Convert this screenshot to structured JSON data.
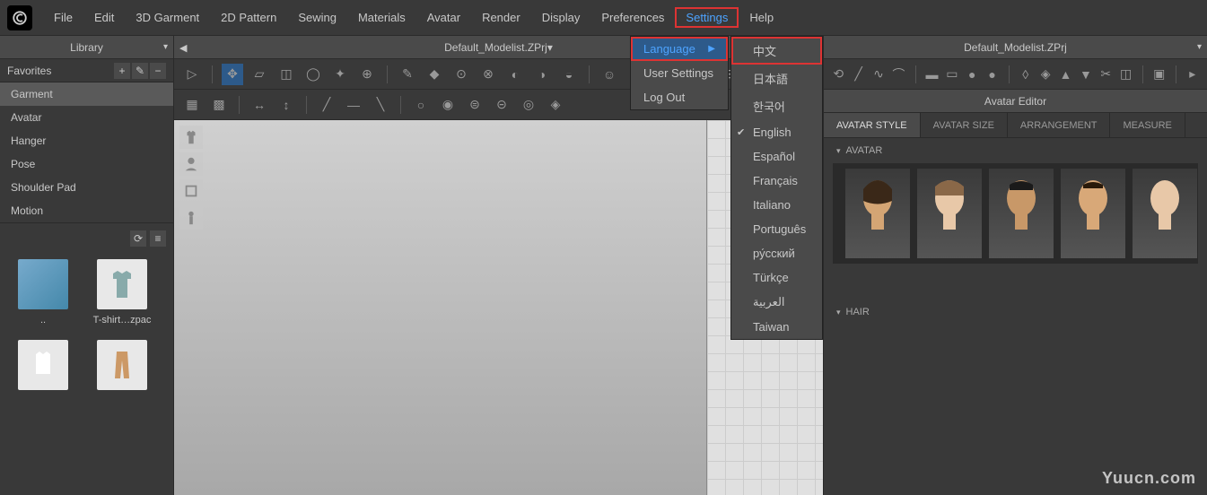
{
  "menubar": {
    "items": [
      "File",
      "Edit",
      "3D Garment",
      "2D Pattern",
      "Sewing",
      "Materials",
      "Avatar",
      "Render",
      "Display",
      "Preferences",
      "Settings",
      "Help"
    ]
  },
  "settings_menu": {
    "items": [
      {
        "label": "Language",
        "has_sub": true,
        "highlight": true
      },
      {
        "label": "User Settings"
      },
      {
        "label": "Log Out"
      }
    ]
  },
  "language_menu": {
    "items": [
      {
        "label": "中文",
        "boxed": true
      },
      {
        "label": "日本語"
      },
      {
        "label": "한국어"
      },
      {
        "label": "English",
        "checked": true
      },
      {
        "label": "Español"
      },
      {
        "label": "Français"
      },
      {
        "label": "Italiano"
      },
      {
        "label": "Português"
      },
      {
        "label": "ру́сский"
      },
      {
        "label": "Türkçe"
      },
      {
        "label": "العربية"
      },
      {
        "label": "Taiwan"
      }
    ]
  },
  "library": {
    "title": "Library",
    "favorites_label": "Favorites",
    "items": [
      "Garment",
      "Avatar",
      "Hanger",
      "Pose",
      "Shoulder Pad",
      "Motion"
    ],
    "selected": "Garment",
    "thumbs": [
      {
        "label": ".."
      },
      {
        "label": "T-shirt…zpac"
      },
      {
        "label": ""
      },
      {
        "label": ""
      }
    ]
  },
  "center": {
    "title": "Default_Modelist.ZPrj"
  },
  "right": {
    "title": "Default_Modelist.ZPrj",
    "editor_title": "Avatar Editor",
    "tabs": [
      "AVATAR STYLE",
      "AVATAR SIZE",
      "ARRANGEMENT",
      "MEASURE"
    ],
    "active_tab": "AVATAR STYLE",
    "sections": {
      "avatar": "AVATAR",
      "hair": "HAIR"
    }
  },
  "watermark": "Yuucn.com"
}
